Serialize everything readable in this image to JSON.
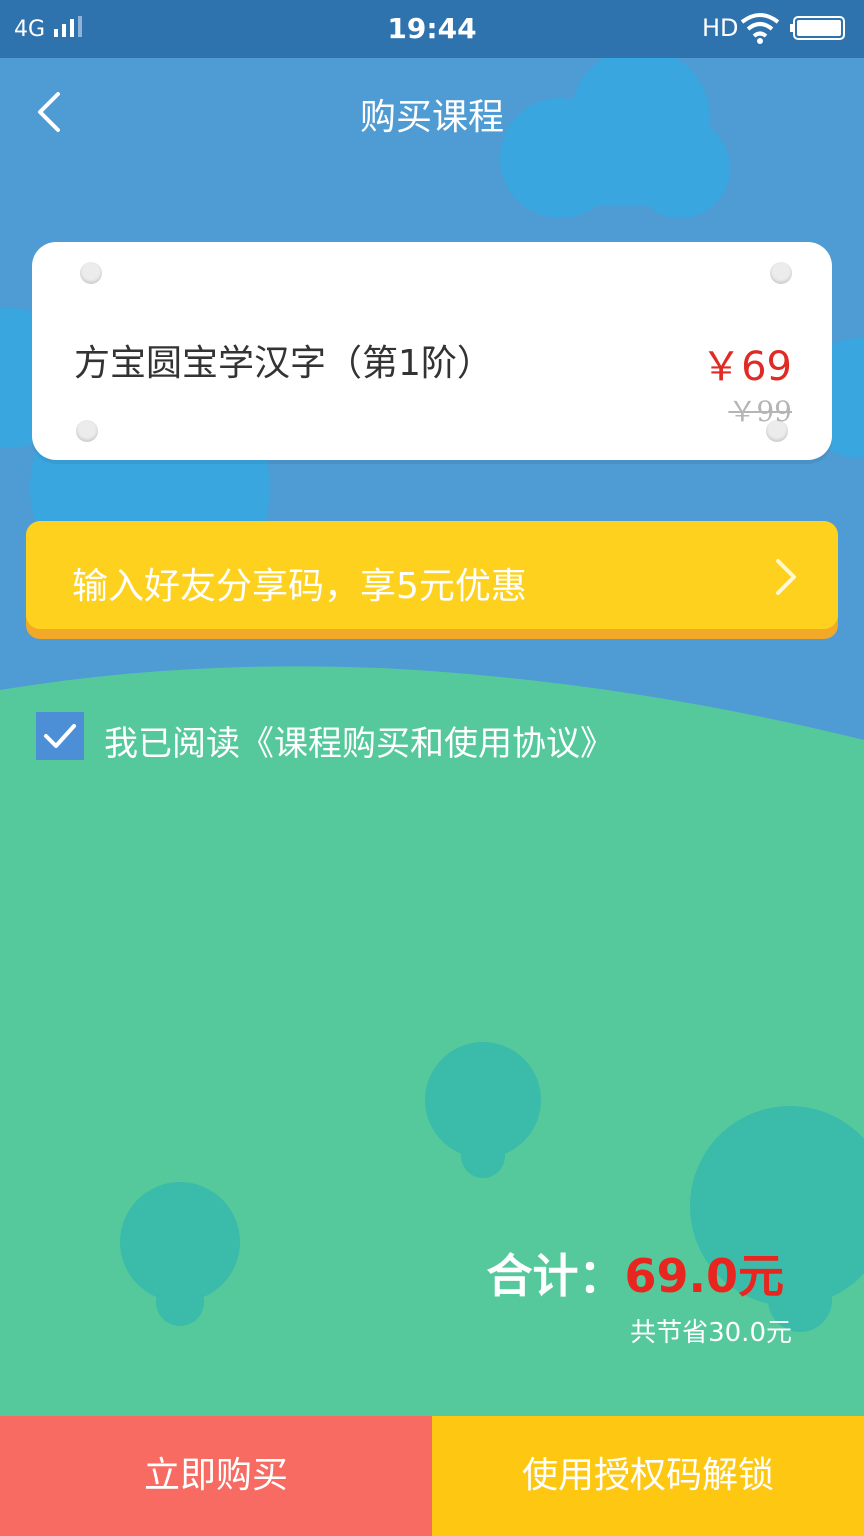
{
  "status_bar": {
    "network": "4G",
    "time": "19:44",
    "hd": "HD"
  },
  "header": {
    "title": "购买课程"
  },
  "course": {
    "name": "方宝圆宝学汉字（第1阶）",
    "price_symbol": "￥",
    "price": "69",
    "original_price": "￥99"
  },
  "coupon": {
    "label": "输入好友分享码，享5元优惠"
  },
  "agreement": {
    "checked": true,
    "text": "我已阅读《课程购买和使用协议》"
  },
  "summary": {
    "total_label": "合计：",
    "total_amount": "69.0元",
    "savings": "共节省30.0元"
  },
  "actions": {
    "buy_label": "立即购买",
    "unlock_label": "使用授权码解锁"
  },
  "colors": {
    "sky": "#4f9bd4",
    "ground": "#56c99c",
    "price_red": "#e02b25",
    "coupon_yellow": "#fdd11e",
    "buy_button": "#f76b62",
    "unlock_button": "#fdc712"
  }
}
